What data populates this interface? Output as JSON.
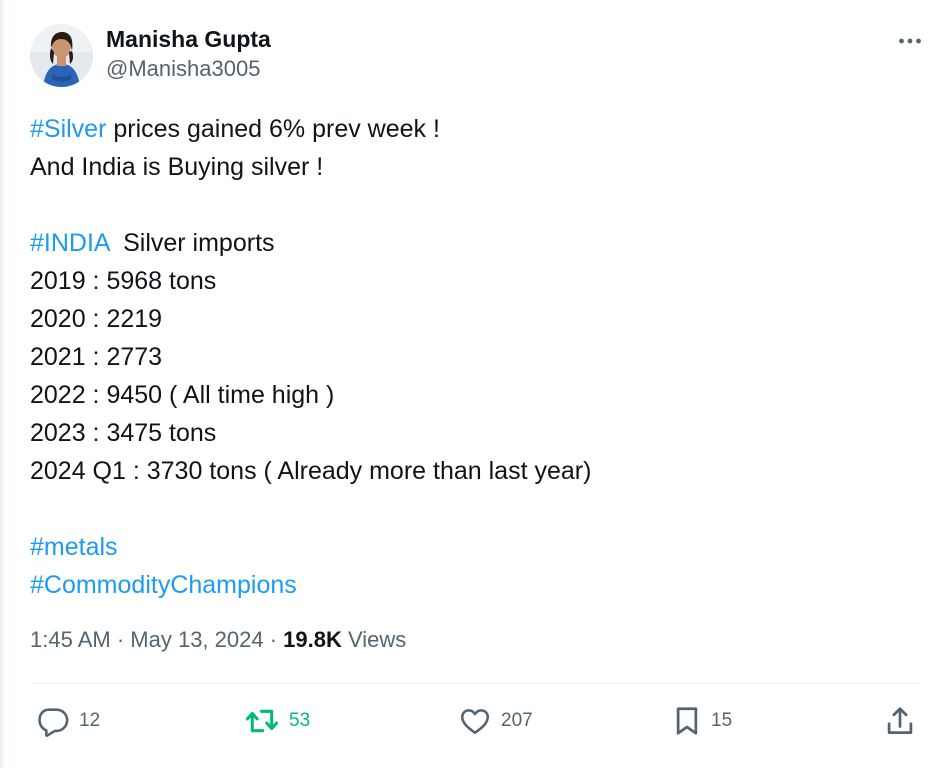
{
  "author": {
    "display_name": "Manisha Gupta",
    "handle": "@Manisha3005"
  },
  "tweet": {
    "lines": [
      {
        "hashtag": "#Silver",
        "text": " prices gained 6% prev week !"
      },
      {
        "text": "And India is Buying silver !"
      },
      {
        "hashtag": "#INDIA",
        "text": "  Silver imports"
      },
      {
        "text": "2019 : 5968 tons"
      },
      {
        "text": "2020 : 2219"
      },
      {
        "text": "2021 : 2773"
      },
      {
        "text": "2022 : 9450 ( All time high )"
      },
      {
        "text": "2023 : 3475 tons"
      },
      {
        "text": "2024 Q1 : 3730 tons ( Already more than last year)"
      },
      {
        "hashtag": "#metals"
      },
      {
        "hashtag": "#CommodityChampions"
      }
    ]
  },
  "meta": {
    "time": "1:45 AM",
    "separator": " · ",
    "date": "May 13, 2024",
    "views_count": "19.8K",
    "views_label": " Views"
  },
  "actions": {
    "replies": "12",
    "reposts": "53",
    "likes": "207",
    "bookmarks": "15"
  },
  "icons": {
    "more": "more-dots-icon",
    "reply": "reply-bubble-icon",
    "repost": "repost-icon",
    "like": "heart-icon",
    "bookmark": "bookmark-icon",
    "share": "share-icon"
  },
  "colors": {
    "hashtag": "#1d9bf0",
    "repost": "#00ba7c",
    "muted": "#536471",
    "text": "#0f1419"
  }
}
